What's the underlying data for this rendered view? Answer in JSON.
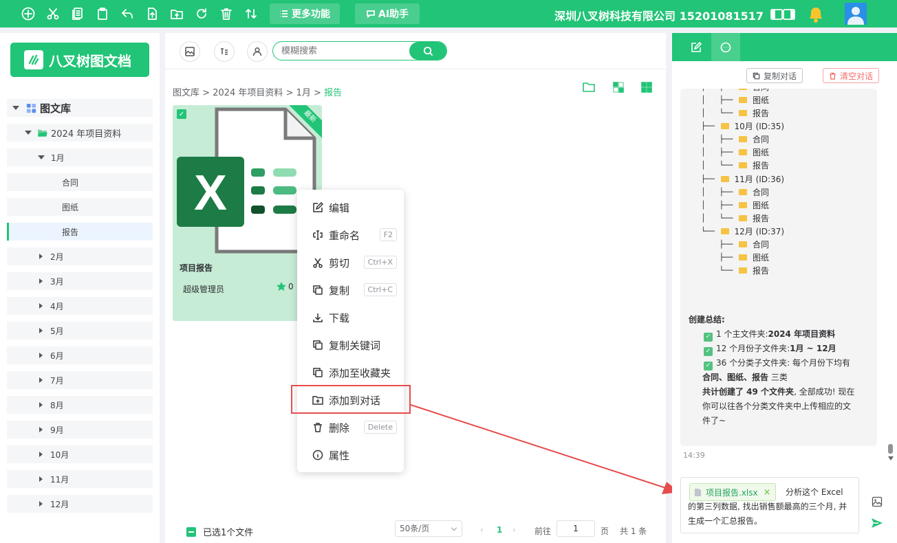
{
  "topbar": {
    "more_label": "更多功能",
    "ai_label": "AI助手",
    "company": "深圳八叉树科技有限公司 15201081517"
  },
  "sidebar": {
    "logo_text": "八叉树图文档",
    "root_label": "图文库",
    "project_label": "2024 年项目资料",
    "month_open": "1月",
    "subfolders": [
      "合同",
      "图纸",
      "报告"
    ],
    "months": [
      "2月",
      "3月",
      "4月",
      "5月",
      "6月",
      "7月",
      "8月",
      "9月",
      "10月",
      "11月",
      "12月"
    ]
  },
  "main": {
    "search_placeholder": "模糊搜索",
    "breadcrumb": {
      "p1": "图文库",
      "p2": "2024 年项目资料",
      "p3": "1月",
      "current": "报告",
      "sep": ">"
    },
    "card": {
      "title": "项目报告",
      "owner": "超级管理员",
      "stars": "0",
      "badge": "最新"
    },
    "footer": {
      "selected": "已选1个文件",
      "page_size": "50条/页",
      "page": "1",
      "goto_label": "前往",
      "goto_value": "1",
      "page_unit": "页",
      "total": "共 1 条"
    }
  },
  "context_menu": {
    "items": [
      {
        "label": "编辑",
        "key": ""
      },
      {
        "label": "重命名",
        "key": "F2"
      },
      {
        "label": "剪切",
        "key": "Ctrl+X"
      },
      {
        "label": "复制",
        "key": "Ctrl+C"
      },
      {
        "label": "下载",
        "key": ""
      },
      {
        "label": "复制关键词",
        "key": ""
      },
      {
        "label": "添加至收藏夹",
        "key": ""
      },
      {
        "label": "添加到对话",
        "key": ""
      },
      {
        "label": "删除",
        "key": "Delete"
      },
      {
        "label": "属性",
        "key": ""
      }
    ]
  },
  "right_panel": {
    "copy_btn": "复制对话",
    "clear_btn": "清空对话",
    "tree": {
      "top_sub": [
        "图纸",
        "报告"
      ],
      "oct": "10月 (ID:35)",
      "nov": "11月 (ID:36)",
      "dec": "12月 (ID:37)",
      "subs": [
        "合同",
        "图纸",
        "报告"
      ]
    },
    "summary": {
      "heading": "创建总结:",
      "l1a": "1 个主文件夹:",
      "l1b": "2024 年项目资料",
      "l2a": "12 个月份子文件夹:",
      "l2b": "1月 ~ 12月",
      "l3": "36 个分类子文件夹: 每个月份下均有",
      "l4a": "合同、图纸、报告",
      "l4b": " 三类",
      "l5a": "共计创建了 49 个文件夹",
      "l5b": ", 全部成功! 现在",
      "l6": "你可以往各个分类文件夹中上传相应的文",
      "l7": "件了~"
    },
    "timestamp": "14:39",
    "input": {
      "attachment": "项目报告.xlsx",
      "message": "分析这个 Excel 的第三列数据, 找出销售额最高的三个月, 并生成一个汇总报告。"
    }
  },
  "colors": {
    "brand": "#22c477",
    "danger": "#e74c4c"
  }
}
